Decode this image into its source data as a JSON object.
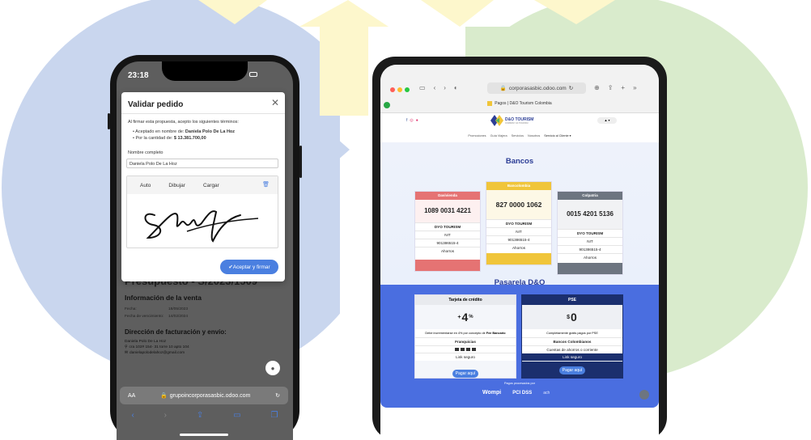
{
  "colors": {
    "bg_blue": "#c9d6ee",
    "bg_green": "#d9ebcc",
    "bg_yellow": "#fdf7cc",
    "accent_blue": "#4a7fe0",
    "navy": "#1b2f6e",
    "red": "#e57373",
    "yellow": "#f0c53a",
    "grey": "#6d7580",
    "brand_blue": "#2c3e96"
  },
  "phone": {
    "status_time": "23:18",
    "modal": {
      "title": "Validar pedido",
      "close_icon": "close-icon",
      "intro": "Al firmar esta propuesta, acepto los siguientes términos:",
      "bullet1_prefix": "Aceptado en nombre de: ",
      "bullet1_value": "Daniela Polo De La Hoz",
      "bullet2_prefix": "Por la cantidad de: ",
      "bullet2_value": "$ 13.381.700,00",
      "name_label": "Nombre completo",
      "name_value": "Daniela Polo De La Hoz",
      "tabs": [
        "Auto",
        "Dibujar",
        "Cargar"
      ],
      "trash_icon": "trash-icon",
      "submit": "Aceptar y firmar"
    },
    "page": {
      "title": "Presupuesto - S/2023/1509",
      "section1": "Información de la venta",
      "fecha_label": "Fecha:",
      "fecha_value": "18/05/2023",
      "venc_label": "Fecha de vencimiento:",
      "venc_value": "14/02/2024",
      "section2": "Dirección de facturación y envío:",
      "addr_name": "Daniela Polo De La Hoz",
      "addr_line": "cra 102# 154- 31 torre 10 apto 104",
      "addr_email": "danielapolodelahoz@gmail.com"
    },
    "url_bar": {
      "aa": "AA",
      "url": "grupoincorporasasbic.odoo.com",
      "reload_icon": "reload-icon"
    },
    "toolbar_icons": [
      "back-icon",
      "forward-icon",
      "share-icon",
      "bookmarks-icon",
      "tabs-icon"
    ]
  },
  "tablet": {
    "url": "corporasasbic.odoo.com",
    "tab_title": "Pagos | D&O Tourism Colombia",
    "logo_text": "D&O TOURISM",
    "logo_sub": "COMPANY AS TOURISM",
    "nav": [
      "Promociones",
      "Guía Viajera",
      "Servicios",
      "Nosotros",
      "Servicio al Cliente ▾"
    ],
    "user": "▲ ▾",
    "bancos_title": "Bancos",
    "banks": [
      {
        "name": "Davivienda",
        "number": "1089 0031 4221",
        "color": "#e57373",
        "rows": [
          "DYO TOURISM",
          "NIT",
          "901386515-4",
          "Ahorros"
        ]
      },
      {
        "name": "Bancolombia",
        "number": "827 0000 1062",
        "color": "#f0c53a",
        "rows": [
          "DYO TOURISM",
          "NIT",
          "901386515-4",
          "Ahorros"
        ]
      },
      {
        "name": "Colpatria",
        "number": "0015 4201 5136",
        "color": "#6d7580",
        "rows": [
          "DYO TOURISM",
          "NIT",
          "901386515-4",
          "Ahorros"
        ]
      }
    ],
    "pasarela_title": "Pasarela D&O",
    "gateways": [
      {
        "name": "Tarjeta de crédito",
        "prefix": "+",
        "value": "4",
        "suffix": "%",
        "desc_prefix": "Debe incrementarse en 4% por concepto de ",
        "desc_bold": "Fee Bancario",
        "row1": "Franquicias",
        "row2": "",
        "row3": "Link seguro",
        "button": "Pagar aquí"
      },
      {
        "name": "PSE",
        "prefix": "$",
        "value": "0",
        "suffix": "",
        "desc_prefix": "Completamente gratis pagos por PSE",
        "desc_bold": "",
        "row1": "Bancos Colombianos",
        "row2": "Cuentas de ahorros o corriente",
        "row3": "Link seguro",
        "button": "Pagar aquí"
      }
    ],
    "powered": "Pagos procesados por",
    "partners": [
      "Wompi",
      "PCI DSS",
      "ach"
    ]
  }
}
